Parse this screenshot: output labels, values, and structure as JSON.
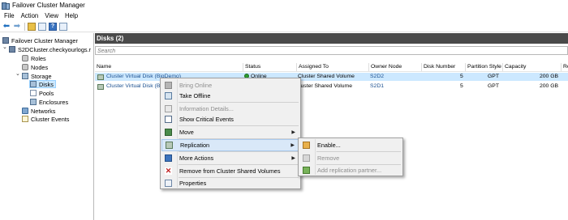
{
  "window": {
    "title": "Failover Cluster Manager"
  },
  "menubar": [
    "File",
    "Action",
    "View",
    "Help"
  ],
  "toolbar": {
    "icons": [
      "back-arrow-icon",
      "forward-arrow-icon",
      "folder-up-icon",
      "show-hide-tree-icon",
      "help-icon",
      "console-icon"
    ],
    "help_glyph": "?"
  },
  "tree": {
    "root": "Failover Cluster Manager",
    "cluster": "S2DCluster.checkyourlogs.r",
    "roles": "Roles",
    "nodes": "Nodes",
    "storage": "Storage",
    "disks": "Disks",
    "pools": "Pools",
    "enclosures": "Enclosures",
    "networks": "Networks",
    "cluster_events": "Cluster Events",
    "expand_glyph": "⌄"
  },
  "main": {
    "header": "Disks (2)",
    "search_placeholder": "Search",
    "columns": [
      "Name",
      "Status",
      "Assigned To",
      "Owner Node",
      "Disk Number",
      "Partition Style",
      "Capacity",
      "Re"
    ],
    "rows": [
      {
        "name": "Cluster Virtual Disk (BigDemo)",
        "status": "Online",
        "assigned_to": "Cluster Shared Volume",
        "owner_node": "S2D2",
        "disk_number": "5",
        "partition_style": "GPT",
        "capacity": "200 GB"
      },
      {
        "name": "Cluster Virtual Disk (Big",
        "status": "",
        "assigned_to": "luster Shared Volume",
        "owner_node": "S2D1",
        "disk_number": "5",
        "partition_style": "GPT",
        "capacity": "200 GB"
      }
    ]
  },
  "context_menu": {
    "items": [
      {
        "label": "Bring Online",
        "icon": "bring-online-icon",
        "disabled": true
      },
      {
        "label": "Take Offline",
        "icon": "take-offline-icon",
        "disabled": false
      },
      {
        "label": "Information Details...",
        "icon": "information-details-icon",
        "disabled": true
      },
      {
        "label": "Show Critical Events",
        "icon": "show-critical-events-icon",
        "disabled": false
      },
      {
        "label": "Move",
        "icon": "move-icon",
        "disabled": false,
        "submenu": true
      },
      {
        "label": "Replication",
        "icon": "replication-icon",
        "disabled": false,
        "submenu": true,
        "highlighted": true
      },
      {
        "label": "More Actions",
        "icon": "more-actions-icon",
        "disabled": false,
        "submenu": true
      },
      {
        "label": "Remove from Cluster Shared Volumes",
        "icon": "remove-from-csv-icon",
        "disabled": false
      },
      {
        "label": "Properties",
        "icon": "properties-icon",
        "disabled": false
      }
    ],
    "chevron": "▶"
  },
  "submenu": {
    "items": [
      {
        "label": "Enable...",
        "icon": "enable-replication-icon",
        "disabled": false
      },
      {
        "label": "Remove",
        "icon": "remove-replication-icon",
        "disabled": true
      },
      {
        "label": "Add replication partner...",
        "icon": "add-replication-partner-icon",
        "disabled": true
      }
    ]
  },
  "colors": {
    "header_bg": "#4a4a4a",
    "selection": "#cce8ff",
    "menu_bg": "#f0f0f0",
    "link_blue": "#1a4f8f"
  }
}
